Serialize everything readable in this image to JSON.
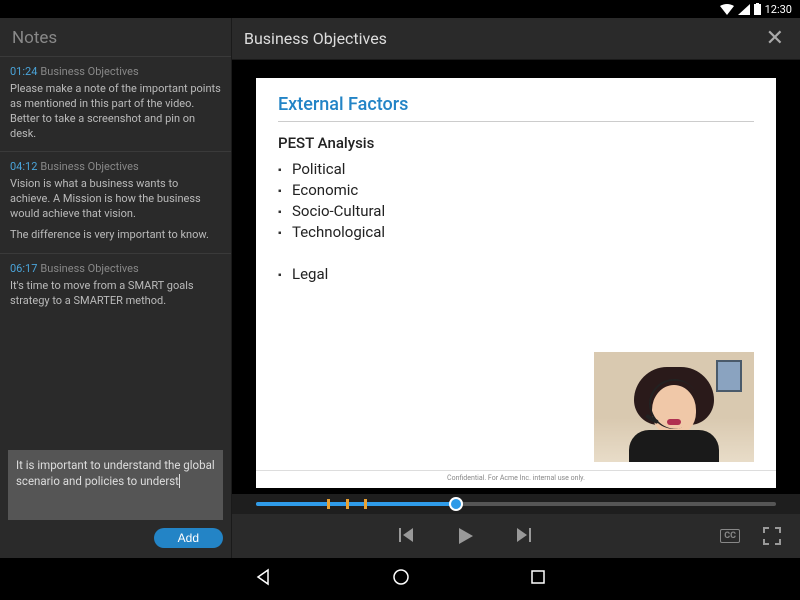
{
  "status": {
    "time": "12:30"
  },
  "sidebar": {
    "title": "Notes",
    "notes": [
      {
        "time": "01:24",
        "title": "Business Objectives",
        "body": "Please make a note of the important points as mentioned in this part of the video. Better to take a screenshot and pin on desk."
      },
      {
        "time": "04:12",
        "title": "Business Objectives",
        "body": "Vision is what a business wants to achieve. A Mission is how the business would achieve that  vision.",
        "body2": "The difference is very important to know."
      },
      {
        "time": "06:17",
        "title": "Business Objectives",
        "body": "It's time to move from a SMART goals strategy to a SMARTER method."
      }
    ],
    "compose": "It is important to understand the global scenario and policies to underst",
    "add_label": "Add"
  },
  "content": {
    "title": "Business Objectives",
    "slide": {
      "title": "External Factors",
      "subtitle": "PEST Analysis",
      "items": [
        "Political",
        "Economic",
        "Socio-Cultural",
        "Technological",
        "",
        "Legal"
      ],
      "footer": "Confidential. For Acme Inc. internal use only."
    }
  },
  "controls": {
    "cc": "CC"
  }
}
